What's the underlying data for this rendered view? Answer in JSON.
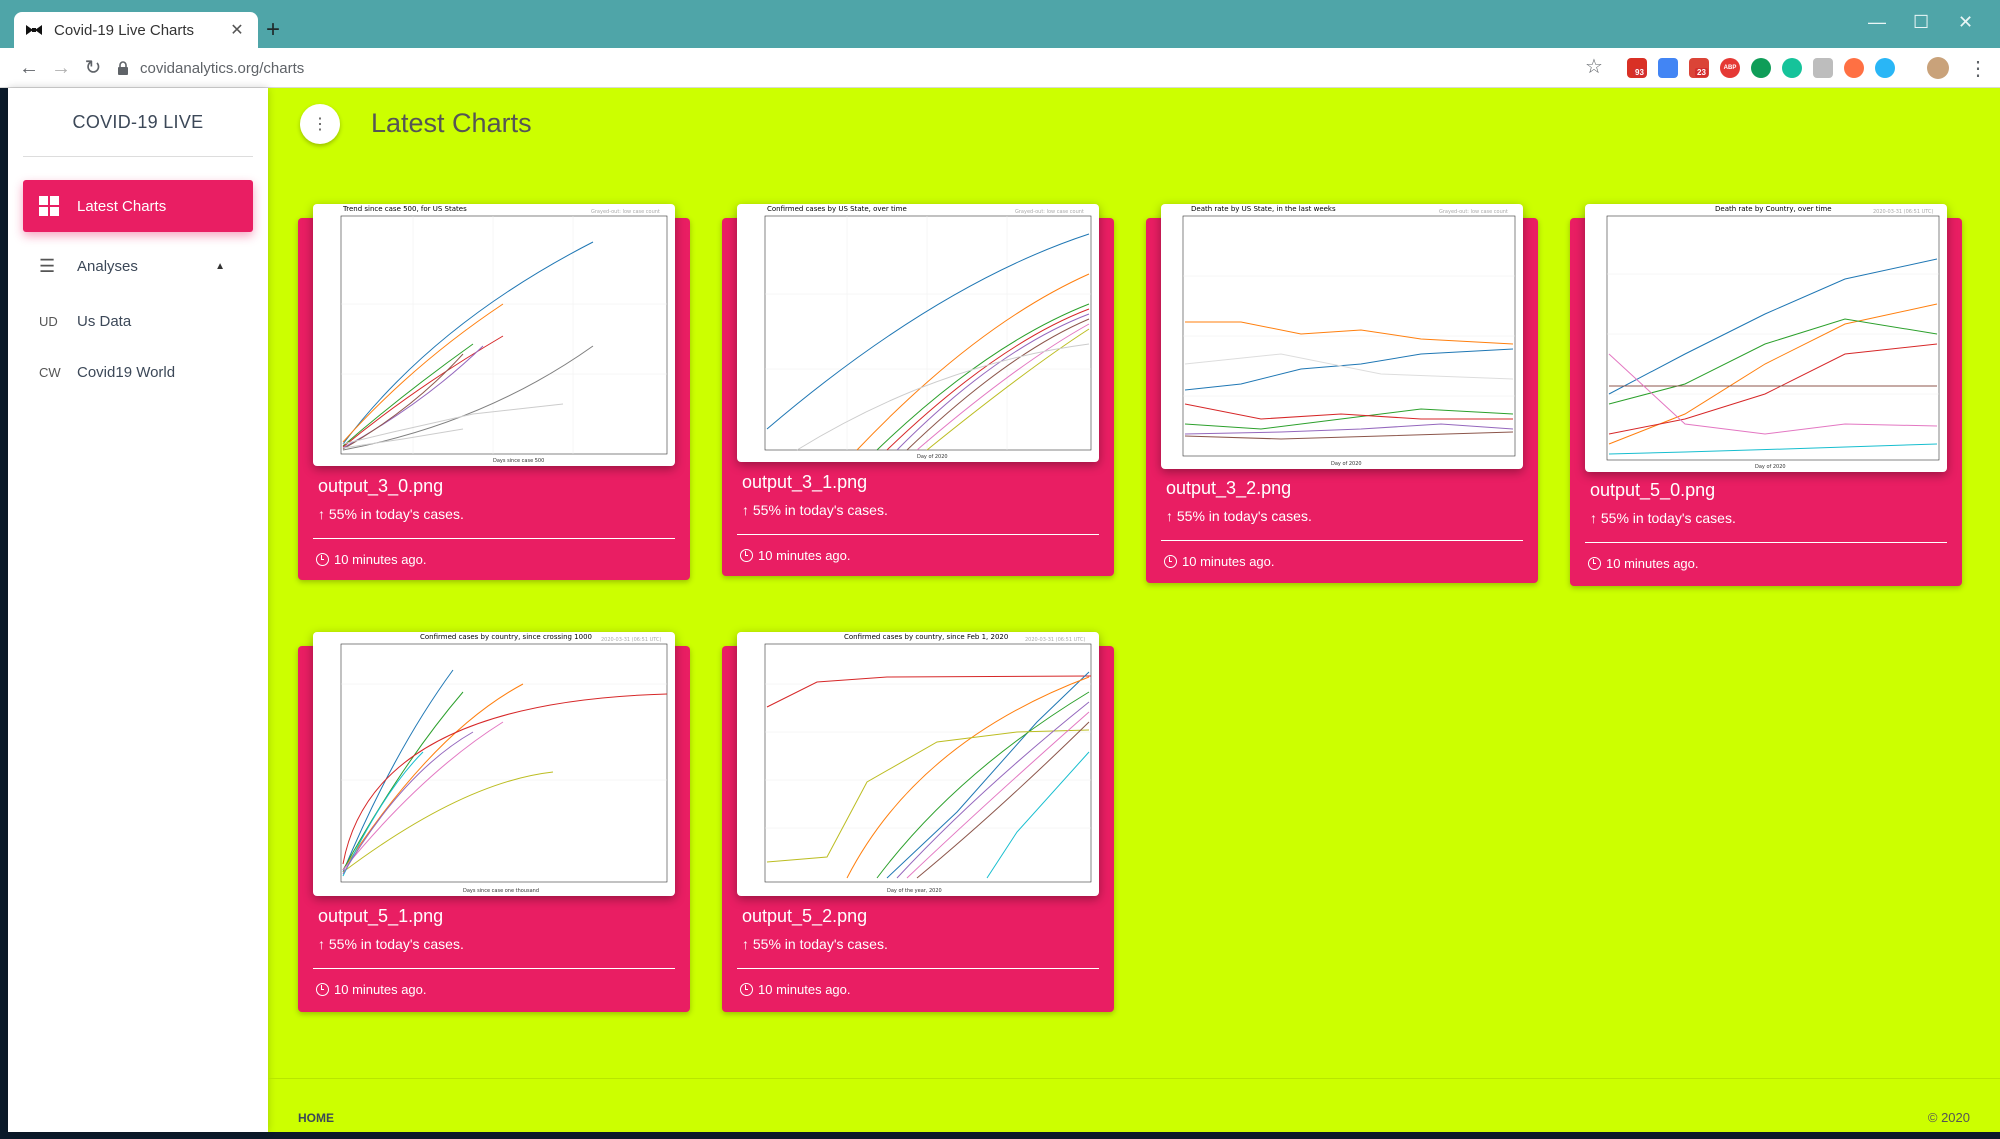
{
  "browser": {
    "tab_title": "Covid-19 Live Charts",
    "url": "covidanalytics.org/charts",
    "ext_badges": [
      "93",
      "23"
    ],
    "ext_abp": "ABP"
  },
  "sidebar": {
    "brand": "COVID-19 LIVE",
    "items": [
      {
        "label": "Latest Charts",
        "icon": "dashboard-icon"
      },
      {
        "label": "Analyses",
        "icon": "notes-icon"
      },
      {
        "label": "Us Data",
        "abbr": "UD"
      },
      {
        "label": "Covid19 World",
        "abbr": "CW"
      }
    ]
  },
  "main": {
    "title": "Latest Charts",
    "cards": [
      {
        "name": "output_3_0.png",
        "stat": "55% in today's cases.",
        "time": "10 minutes ago.",
        "chart_title": "Trend since case 500, for US States",
        "note": "Grayed-out: low case count",
        "xlabel": "Days since case 500"
      },
      {
        "name": "output_3_1.png",
        "stat": "55% in today's cases.",
        "time": "10 minutes ago.",
        "chart_title": "Confirmed cases by US State, over time",
        "note": "Grayed-out: low case count",
        "xlabel": "Day of 2020"
      },
      {
        "name": "output_3_2.png",
        "stat": "55% in today's cases.",
        "time": "10 minutes ago.",
        "chart_title": "Death rate by US State, in the last weeks",
        "note": "Grayed-out: low case count",
        "xlabel": "Day of 2020"
      },
      {
        "name": "output_5_0.png",
        "stat": "55% in today's cases.",
        "time": "10 minutes ago.",
        "chart_title": "Death rate by Country, over time",
        "note": "2020-03-31 (06:51 UTC)",
        "xlabel": "Day of 2020"
      },
      {
        "name": "output_5_1.png",
        "stat": "55% in today's cases.",
        "time": "10 minutes ago.",
        "chart_title": "Confirmed cases by country, since crossing 1000",
        "note": "2020-03-31 (06:51 UTC)",
        "xlabel": "Days since case one thousand"
      },
      {
        "name": "output_5_2.png",
        "stat": "55% in today's cases.",
        "time": "10 minutes ago.",
        "chart_title": "Confirmed cases by country, since Feb 1, 2020",
        "note": "2020-03-31 (06:51 UTC)",
        "xlabel": "Day of the year, 2020"
      }
    ]
  },
  "footer": {
    "home": "HOME",
    "copyright": "© 2020"
  },
  "colors": {
    "page_bg": "#ccff00",
    "card_bg": "#e91e63",
    "sidebar_active": "#e91e63",
    "tabstrip": "#4fa5a8"
  }
}
